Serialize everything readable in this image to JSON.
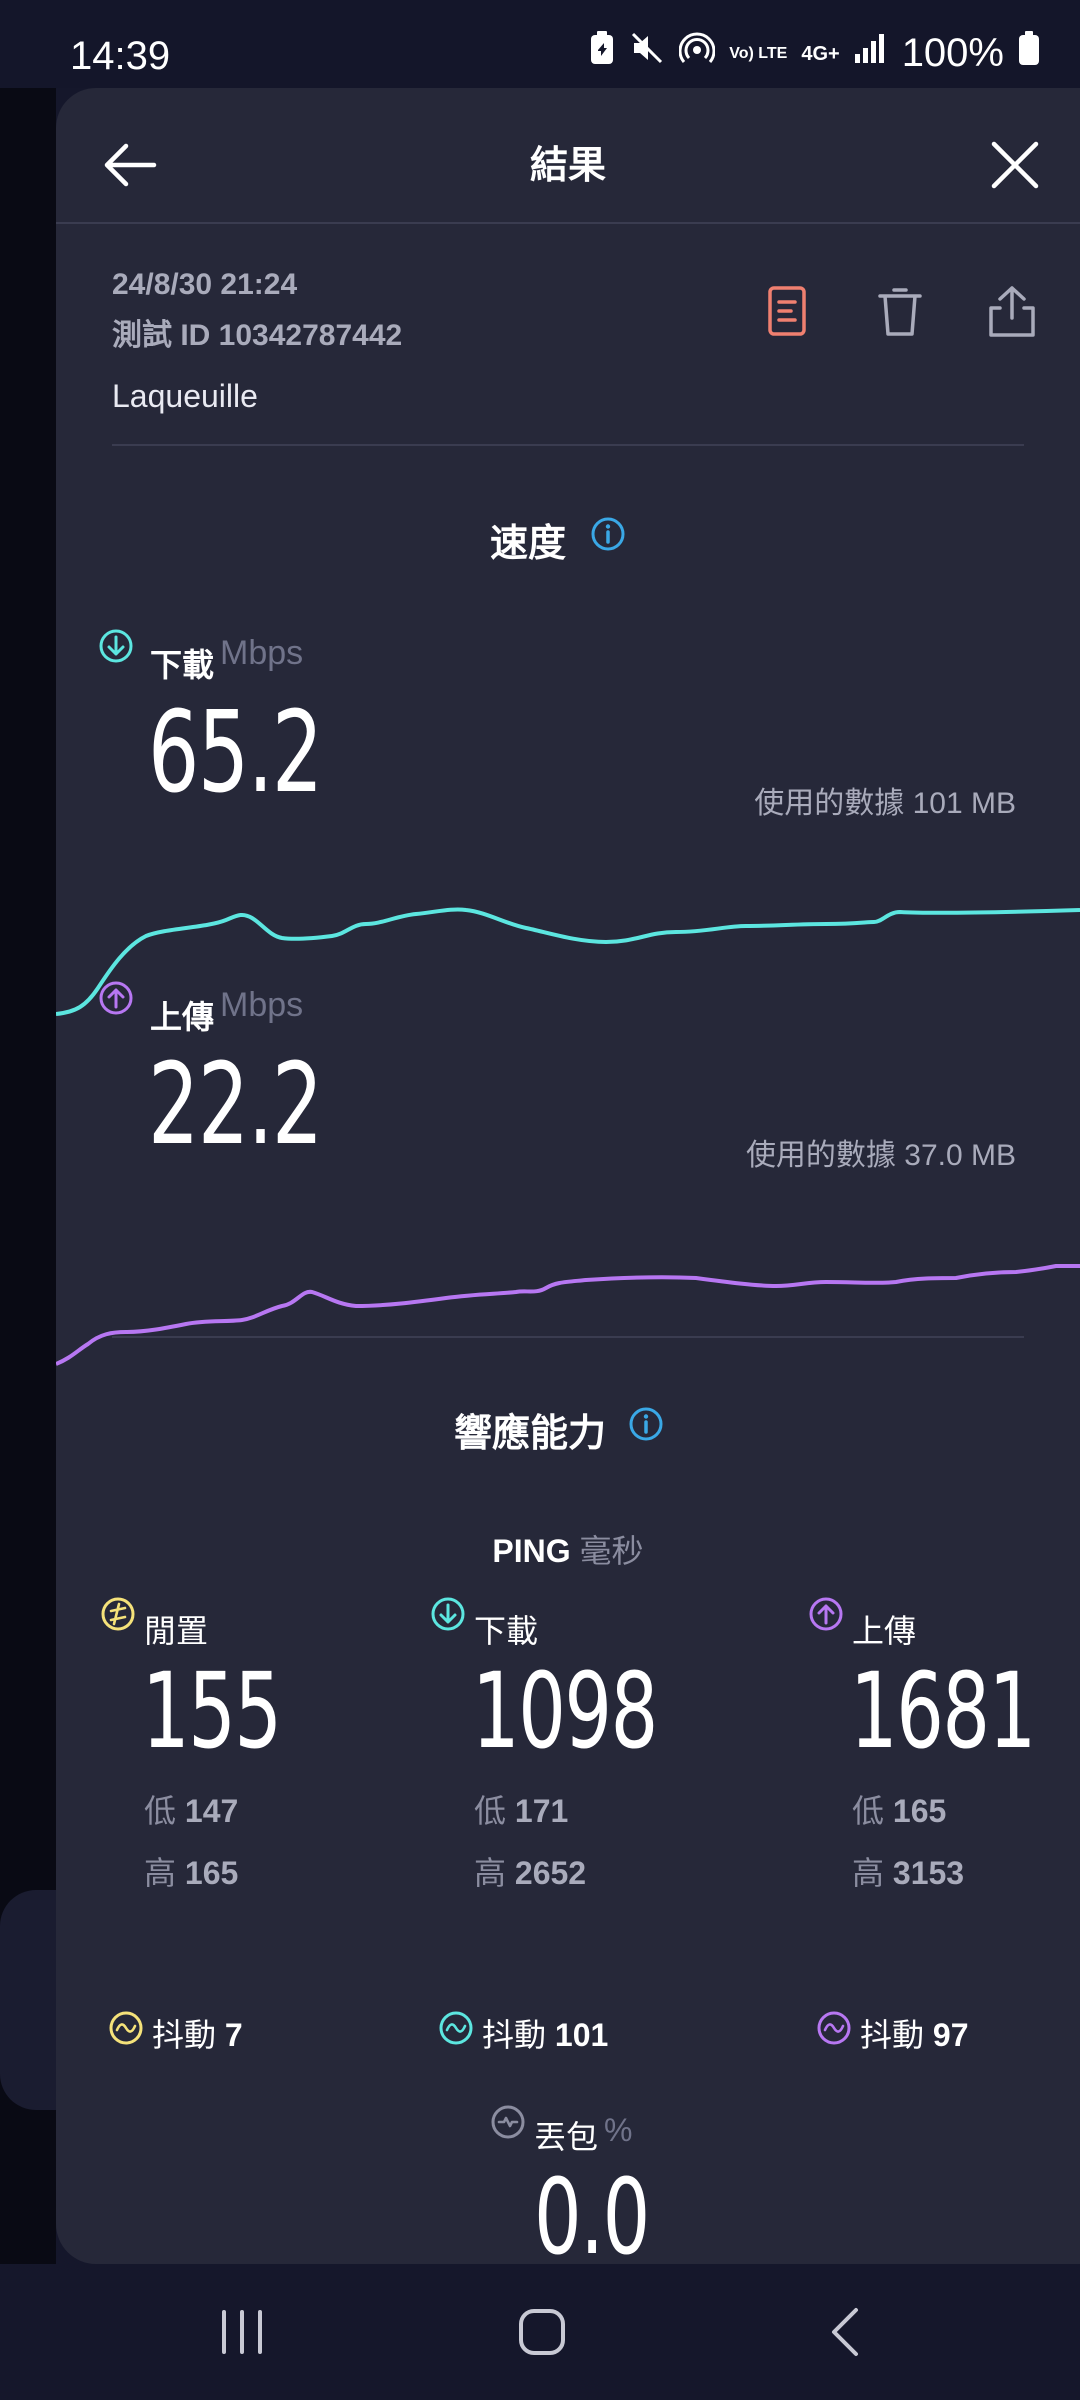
{
  "status": {
    "time": "14:39",
    "battery": "100%",
    "network": "4G+",
    "volte": "Vo) LTE"
  },
  "header": {
    "title": "結果"
  },
  "meta": {
    "date": "24/8/30 21:24",
    "test_id": "測試 ID 10342787442",
    "location": "Laqueuille"
  },
  "speed": {
    "title": "速度",
    "download": {
      "label": "下載",
      "unit": "Mbps",
      "value": "65.2",
      "data_used": "使用的數據 101 MB",
      "color": "#5ce6e0"
    },
    "upload": {
      "label": "上傳",
      "unit": "Mbps",
      "value": "22.2",
      "data_used": "使用的數據 37.0 MB",
      "color": "#b777f2"
    }
  },
  "responsiveness": {
    "title": "響應能力",
    "ping_label": "PING",
    "ping_unit": "毫秒",
    "idle": {
      "label": "閒置",
      "value": "155",
      "low_label": "低",
      "low": "147",
      "high_label": "高",
      "high": "165",
      "jitter_label": "抖動",
      "jitter": "7",
      "color": "#f5e27a"
    },
    "download": {
      "label": "下載",
      "value": "1098",
      "low_label": "低",
      "low": "171",
      "high_label": "高",
      "high": "2652",
      "jitter_label": "抖動",
      "jitter": "101",
      "color": "#5ce6e0"
    },
    "upload": {
      "label": "上傳",
      "value": "1681",
      "low_label": "低",
      "low": "165",
      "high_label": "高",
      "high": "3153",
      "jitter_label": "抖動",
      "jitter": "97",
      "color": "#b777f2"
    }
  },
  "packet_loss": {
    "label": "丟包",
    "unit": "%",
    "value": "0.0"
  },
  "colors": {
    "accent_red": "#f08070",
    "info_blue": "#3aa8e6"
  }
}
